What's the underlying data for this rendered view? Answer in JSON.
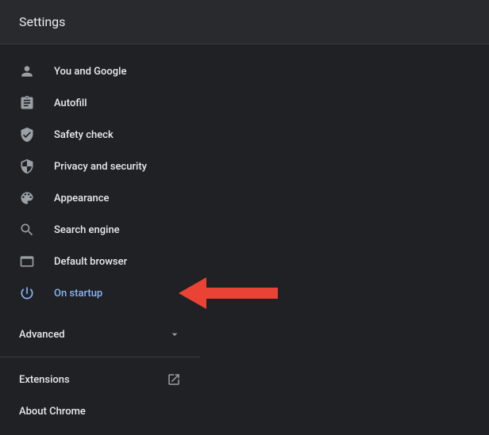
{
  "header": {
    "title": "Settings"
  },
  "sidebar": {
    "items": [
      {
        "label": "You and Google",
        "icon": "person-icon",
        "selected": false
      },
      {
        "label": "Autofill",
        "icon": "autofill-icon",
        "selected": false
      },
      {
        "label": "Safety check",
        "icon": "safety-icon",
        "selected": false
      },
      {
        "label": "Privacy and security",
        "icon": "shield-icon",
        "selected": false
      },
      {
        "label": "Appearance",
        "icon": "palette-icon",
        "selected": false
      },
      {
        "label": "Search engine",
        "icon": "search-icon",
        "selected": false
      },
      {
        "label": "Default browser",
        "icon": "browser-icon",
        "selected": false
      },
      {
        "label": "On startup",
        "icon": "power-icon",
        "selected": true
      }
    ],
    "advanced": {
      "label": "Advanced"
    },
    "footer": [
      {
        "label": "Extensions",
        "external": true
      },
      {
        "label": "About Chrome",
        "external": false
      }
    ]
  },
  "annotation": {
    "type": "arrow",
    "color": "#ea4335",
    "target": "On startup"
  }
}
